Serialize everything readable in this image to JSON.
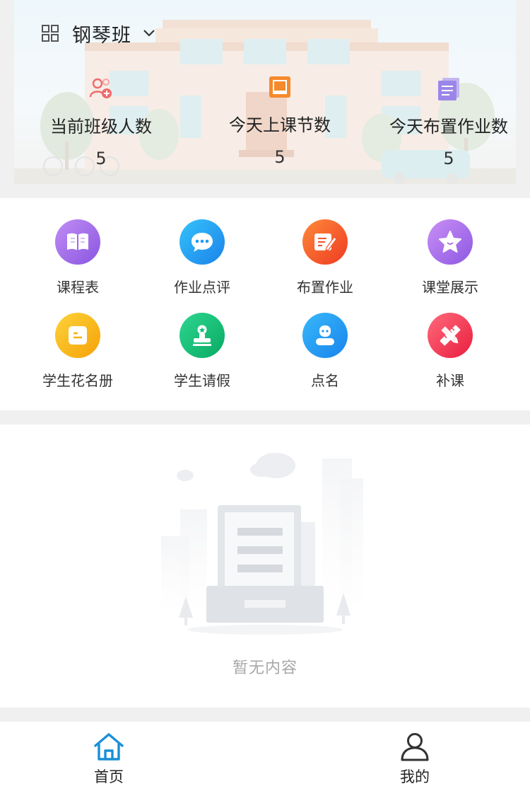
{
  "header": {
    "class_name": "钢琴班",
    "icons": {
      "menu": "grid-icon",
      "dropdown": "chevron-down-icon"
    }
  },
  "stats": [
    {
      "label": "当前班级人数",
      "value": "5",
      "icon": "add-user-icon",
      "color": "#f06a6a"
    },
    {
      "label": "今天上课节数",
      "value": "5",
      "icon": "lesson-square-icon",
      "color": "#f58a2c"
    },
    {
      "label": "今天布置作业数",
      "value": "5",
      "icon": "homework-doc-icon",
      "color": "#9b86e8"
    }
  ],
  "menu": [
    {
      "label": "课程表",
      "icon": "book-icon",
      "color": "#9a68e8"
    },
    {
      "label": "作业点评",
      "icon": "chat-bubble-icon",
      "color": "#1e9bf0"
    },
    {
      "label": "布置作业",
      "icon": "edit-note-icon",
      "color": "#f4532a"
    },
    {
      "label": "课堂展示",
      "icon": "star-icon",
      "color": "#a36de6"
    },
    {
      "label": "学生花名册",
      "icon": "roster-icon",
      "color": "#f8b20e"
    },
    {
      "label": "学生请假",
      "icon": "stamp-icon",
      "color": "#11c07a"
    },
    {
      "label": "点名",
      "icon": "person-icon",
      "color": "#2194ee"
    },
    {
      "label": "补课",
      "icon": "pencil-ruler-icon",
      "color": "#f0384f"
    }
  ],
  "empty": {
    "text": "暂无内容"
  },
  "tabbar": [
    {
      "label": "首页",
      "icon": "home-icon",
      "active": true
    },
    {
      "label": "我的",
      "icon": "profile-icon",
      "active": false
    }
  ],
  "colors": {
    "accent": "#1a8fd6",
    "page_bg": "#f0f0f0",
    "text": "#222222",
    "muted": "#a8a8a8"
  }
}
